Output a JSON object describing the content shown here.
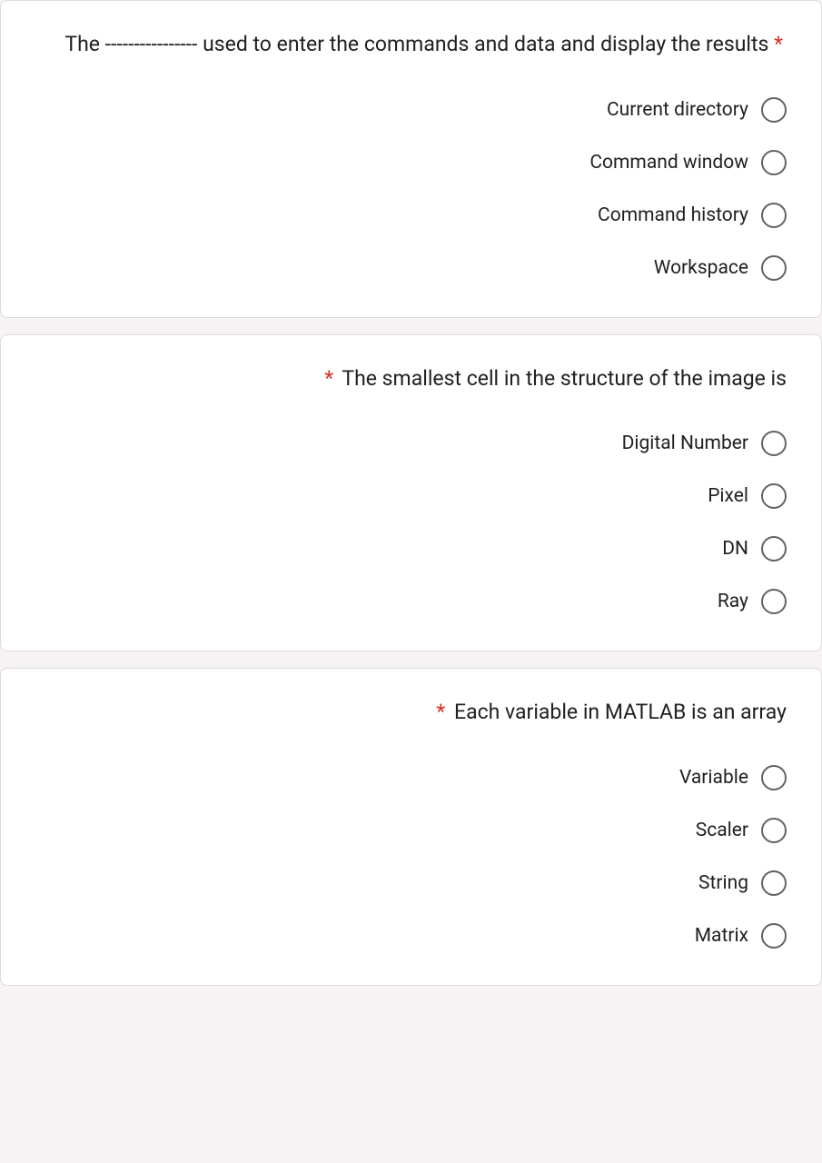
{
  "required_marker": "*",
  "questions": [
    {
      "text": "The ---------------- used to enter the commands and data and display the results",
      "options": [
        "Current directory",
        "Command window",
        "Command history",
        "Workspace"
      ]
    },
    {
      "text": "The smallest cell in the structure of the image is",
      "options": [
        "Digital Number",
        "Pixel",
        "DN",
        "Ray"
      ]
    },
    {
      "text": "Each variable in MATLAB is an array",
      "options": [
        "Variable",
        "Scaler",
        "String",
        "Matrix"
      ]
    }
  ]
}
